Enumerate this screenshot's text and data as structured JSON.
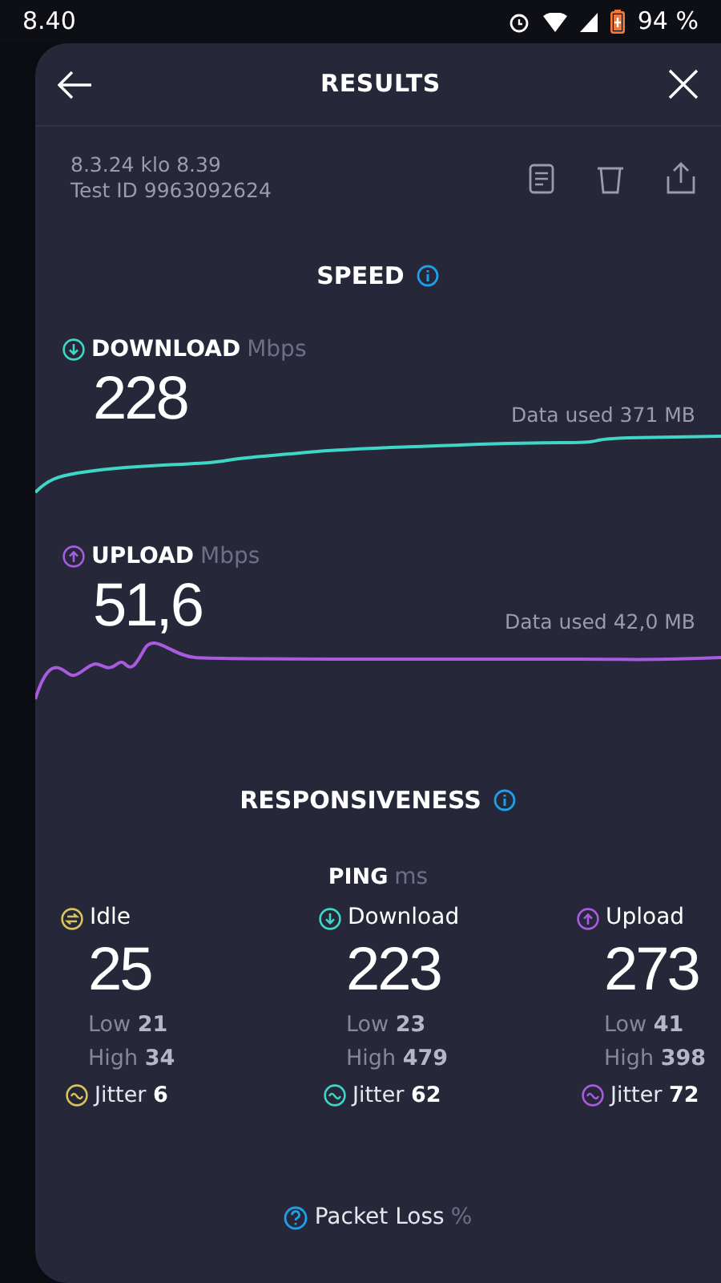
{
  "status_bar": {
    "time": "8.40",
    "battery": "94 %"
  },
  "header": {
    "title": "RESULTS"
  },
  "test": {
    "date": "8.3.24 klo 8.39",
    "test_id": "Test ID 9963092624"
  },
  "speed": {
    "title": "SPEED",
    "items": [
      {
        "kind": "download",
        "label": "DOWNLOAD",
        "unit": "Mbps",
        "value": "228",
        "data_used": "Data used 371 MB",
        "color": "#3fd6c8"
      },
      {
        "kind": "upload",
        "label": "UPLOAD",
        "unit": "Mbps",
        "value": "51,6",
        "data_used": "Data used 42,0 MB",
        "color": "#a95be0"
      }
    ]
  },
  "responsiveness": {
    "title": "RESPONSIVENESS",
    "ping_label": "PING",
    "ping_unit": "ms",
    "columns": [
      {
        "kind": "idle",
        "label": "Idle",
        "value": "25",
        "low": "Low **21**",
        "high": "High **34**",
        "jitter": "Jitter **6**",
        "color": "#d9c35a"
      },
      {
        "kind": "download",
        "label": "Download",
        "value": "223",
        "low": "Low **23**",
        "high": "High **479**",
        "jitter": "Jitter **62**",
        "color": "#3fd6c8"
      },
      {
        "kind": "upload",
        "label": "Upload",
        "value": "273",
        "low": "Low **41**",
        "high": "High **398**",
        "jitter": "Jitter **72**",
        "color": "#a95be0"
      }
    ]
  },
  "packet_loss": {
    "label": "Packet Loss",
    "unit": "%"
  }
}
